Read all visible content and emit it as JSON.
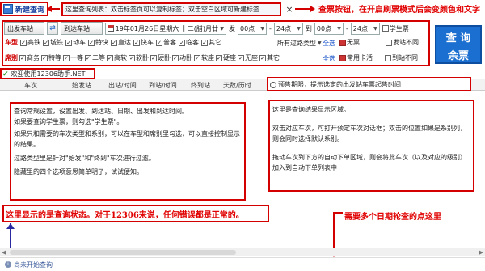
{
  "toolbar": {
    "new_query_label": "新建查询",
    "query_list_hint": "这里查询列表：双击标签页可以复制标签；双击空白区域可新建标签",
    "close_symbol": "×"
  },
  "top_callout": "查票按钮，在开启刷票模式后会变颜色和文字",
  "query_button": {
    "line1": "查 询",
    "line2": "余票"
  },
  "search": {
    "from_label": "出发车站",
    "to_label": "到达车站",
    "date_value": "19年01月26日星期六 十二(腊)月廿一",
    "send_label": "发",
    "time_from_1": "00点",
    "time_to_1": "24点",
    "arrive_label": "到",
    "time_from_2": "00点",
    "time_to_2": "24点",
    "student_label": "学生票"
  },
  "train_types": {
    "label": "车型",
    "items": [
      "高铁",
      "城铁",
      "动车",
      "特快",
      "直达",
      "快车",
      "普客",
      "临客",
      "其它"
    ],
    "station_filter": "所有过路类型",
    "select_all": "全选"
  },
  "seat_types": {
    "label": "席别",
    "items": [
      "商务",
      "特等",
      "一等",
      "二等",
      "高软",
      "软卧",
      "硬卧",
      "动卧",
      "软座",
      "硬座",
      "无座",
      "其它"
    ],
    "select_all": "全选"
  },
  "right_checks": {
    "no_ticket": "无票",
    "often_unavailable": "常用卡活",
    "start_no_sale": "发站不同",
    "arrive_no_sale": "到站不同"
  },
  "welcome": "欢迎使用12306助手.NET",
  "table_headers": [
    "车次",
    "始发站",
    "出站/时间",
    "到站/时间",
    "终到站",
    "天数/历时",
    "商务",
    "特等",
    "一等",
    "二等"
  ],
  "tip_bar": "预售期限，提示选定的出发站车票起售时间",
  "left_notes": [
    "查询常规设置，设置出发、到达站、日期、出发和到达时间。",
    "如果要查询学生票，则勾选\"学生票\"。",
    "如果只和需要的车次类型和系别，可以在车型和席别里勾选，可以直接控制显示的结果。",
    "过路类型里是针对\"始发\"和\"终到\"车次进行过滤。",
    "隐藏里的四个选项意思简单明了，试试便知。"
  ],
  "right_notes": [
    "这里是查询结果显示区域。",
    "双击对应车次，可打开预定车次对话框；双击的位置如果是系别列，则会同时选择默认系别。",
    "拖动车次到下方的自动下单区域，则会将此车次（以及对应的级别）加入到自动下单列表中"
  ],
  "bottom_left_callout": "这里显示的是查询状态。对于12306来说，任何错误都是正常的。",
  "bottom_right_callout": "需要多个日期轮查的点这里",
  "status_text": "尚未开始查询",
  "colors": {
    "accent_red": "#d40000",
    "brand_blue": "#1b6fd0"
  }
}
